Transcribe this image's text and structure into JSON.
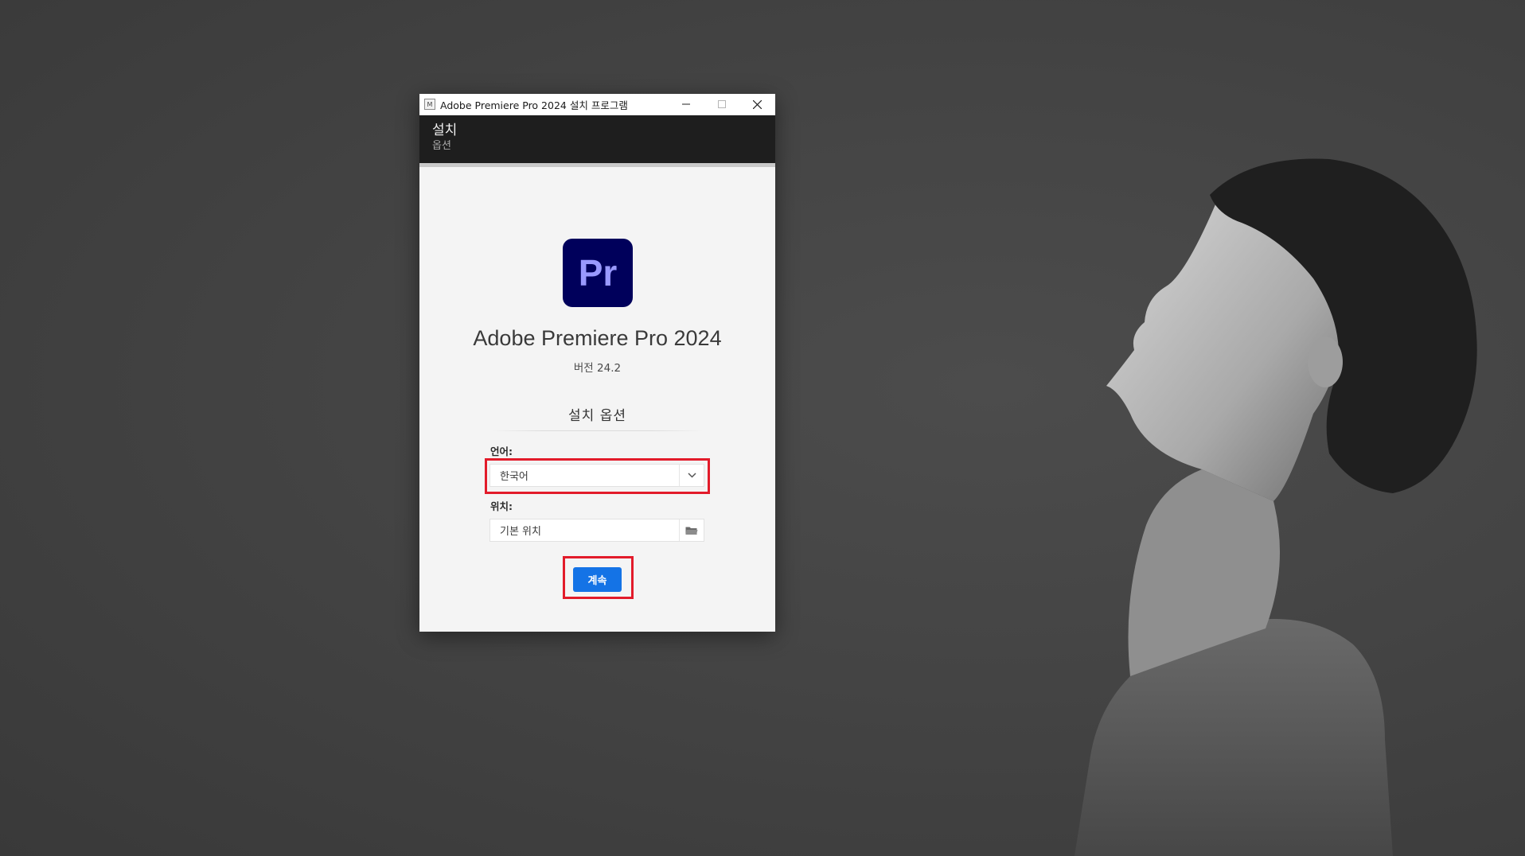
{
  "window": {
    "title": "Adobe Premiere Pro 2024 설치 프로그램",
    "icon_text": "M",
    "icon": "installer-app-icon",
    "controls": [
      "minimize-icon",
      "maximize-icon",
      "close-icon"
    ]
  },
  "header": {
    "title": "설치",
    "subtitle": "옵션"
  },
  "product": {
    "logo_text": "Pr",
    "logo_color": "#00005b",
    "logo_text_color": "#9999ff",
    "name": "Adobe Premiere Pro 2024",
    "version": "버전 24.2"
  },
  "options": {
    "section_title": "설치 옵션",
    "language_label": "언어:",
    "language_value": "한국어",
    "location_label": "위치:",
    "location_value": "기본 위치"
  },
  "actions": {
    "continue_label": "계속",
    "accent_color": "#1473e6"
  },
  "highlight_color": "#e21b2a"
}
